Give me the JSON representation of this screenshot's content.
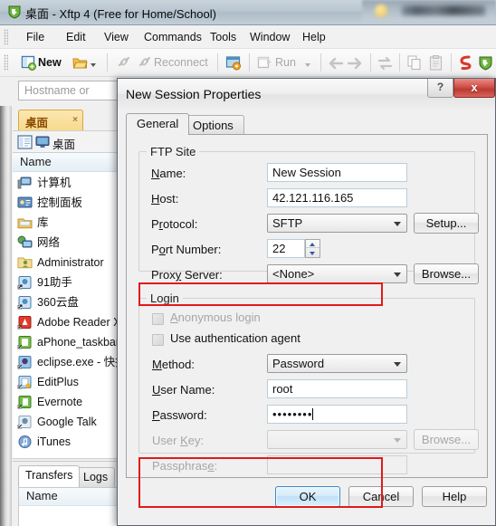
{
  "window": {
    "icon": "xftp-logo-icon",
    "title": "桌面 - Xftp 4 (Free for Home/School)",
    "menus": [
      "File",
      "Edit",
      "View",
      "Commands",
      "Tools",
      "Window",
      "Help"
    ]
  },
  "toolbar": {
    "new_label": "New",
    "open_icon": "open-folder-icon",
    "connect_icon": "connect-icon",
    "reconnect_label": "Reconnect",
    "properties_icon": "session-properties-icon",
    "run_label": "Run",
    "back_icon": "back-arrow-icon",
    "forward_icon": "forward-arrow-icon",
    "sync_icon": "sync-transfer-icon",
    "copy_icon": "copy-icon",
    "paste_icon": "paste-icon",
    "xshell_icon": "xshell-icon",
    "xftp_icon": "xftp-icon"
  },
  "address": {
    "placeholder": "Hostname or"
  },
  "left_panel": {
    "tab_label": "桌面",
    "tab_close": "×",
    "view_icon": "folder-view-icon",
    "location_icon": "desktop-icon",
    "location_label": "桌面",
    "column_name": "Name",
    "items": [
      {
        "icon": "computer-icon",
        "label": "计算机"
      },
      {
        "icon": "control-panel-icon",
        "label": "控制面板"
      },
      {
        "icon": "library-icon",
        "label": "库"
      },
      {
        "icon": "network-icon",
        "label": "网络"
      },
      {
        "icon": "user-folder-icon",
        "label": "Administrator"
      },
      {
        "icon": "shortcut-icon",
        "label": "91助手"
      },
      {
        "icon": "shortcut-icon",
        "label": "360云盘"
      },
      {
        "icon": "adobe-icon",
        "label": "Adobe Reader X"
      },
      {
        "icon": "shortcut-icon",
        "label": "aPhone_taskbar"
      },
      {
        "icon": "shortcut-icon",
        "label": "eclipse.exe - 快捷"
      },
      {
        "icon": "shortcut-icon",
        "label": "EditPlus"
      },
      {
        "icon": "evernote-icon",
        "label": "Evernote"
      },
      {
        "icon": "shortcut-icon",
        "label": "Google Talk"
      },
      {
        "icon": "itunes-icon",
        "label": "iTunes"
      }
    ]
  },
  "bottom_panel": {
    "tabs": [
      {
        "label": "Transfers",
        "active": true
      },
      {
        "label": "Logs",
        "active": false
      }
    ],
    "column_name": "Name"
  },
  "dialog": {
    "title": "New Session Properties",
    "help_button": "?",
    "close_button": "x",
    "tabs": [
      {
        "label": "General",
        "active": true
      },
      {
        "label": "Options",
        "active": false
      }
    ],
    "ftp_site": {
      "legend": "FTP Site",
      "name_label": "Name:",
      "name_value": "New Session",
      "host_label": "Host:",
      "host_value": "42.121.116.165",
      "protocol_label": "Protocol:",
      "protocol_value": "SFTP",
      "setup_button": "Setup...",
      "port_label": "Port Number:",
      "port_value": "22",
      "proxy_label": "Proxy Server:",
      "proxy_value": "<None>",
      "browse_button": "Browse..."
    },
    "login": {
      "legend": "Login",
      "anonymous_label": "Anonymous login",
      "anonymous_checked": false,
      "auth_agent_label": "Use authentication agent",
      "auth_agent_checked": false,
      "method_label": "Method:",
      "method_value": "Password",
      "username_label": "User Name:",
      "username_value": "root",
      "password_label": "Password:",
      "password_value": "••••••••",
      "userkey_label": "User Key:",
      "userkey_value": "",
      "userkey_browse_button": "Browse...",
      "passphrase_label": "Passphrase:",
      "passphrase_value": ""
    },
    "buttons": {
      "ok": "OK",
      "cancel": "Cancel",
      "help": "Help"
    }
  },
  "annotations": {
    "highlight_color": "#e01b1b",
    "boxes": [
      "protocol-row",
      "credentials-rows"
    ]
  }
}
